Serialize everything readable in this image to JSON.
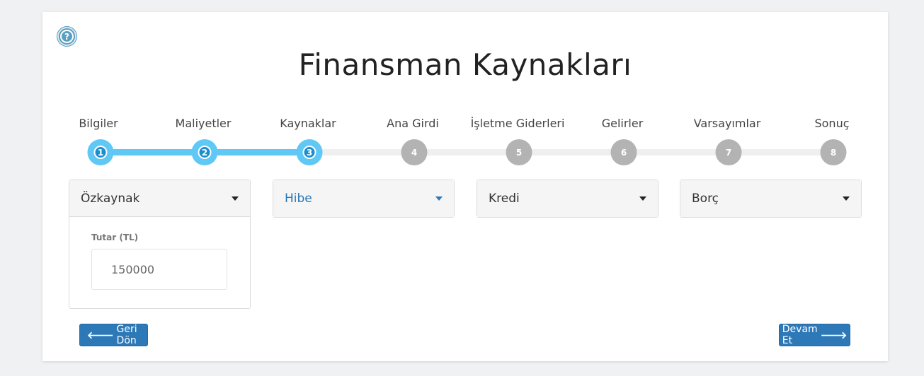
{
  "page": {
    "title": "Finansman Kaynakları"
  },
  "help": {
    "icon": "help-question-icon",
    "glyph": "?"
  },
  "steps": [
    {
      "label": "Bilgiler",
      "number": "1",
      "active": true
    },
    {
      "label": "Maliyetler",
      "number": "2",
      "active": true
    },
    {
      "label": "Kaynaklar",
      "number": "3",
      "active": true
    },
    {
      "label": "Ana Girdi",
      "number": "4",
      "active": false
    },
    {
      "label": "İşletme Giderleri",
      "number": "5",
      "active": false
    },
    {
      "label": "Gelirler",
      "number": "6",
      "active": false
    },
    {
      "label": "Varsayımlar",
      "number": "7",
      "active": false
    },
    {
      "label": "Sonuç",
      "number": "8",
      "active": false
    }
  ],
  "panels": [
    {
      "title": "Özkaynak",
      "expanded": true,
      "field_label": "Tutar (TL)",
      "field_value": "150000"
    },
    {
      "title": "Hibe",
      "expanded": false
    },
    {
      "title": "Kredi",
      "expanded": false
    },
    {
      "title": "Borç",
      "expanded": false
    }
  ],
  "buttons": {
    "back": "Geri Dön",
    "next": "Devam Et"
  },
  "colors": {
    "accent": "#5fc8f5",
    "primary": "#2d79b8",
    "inactive": "#b3b3b3"
  }
}
